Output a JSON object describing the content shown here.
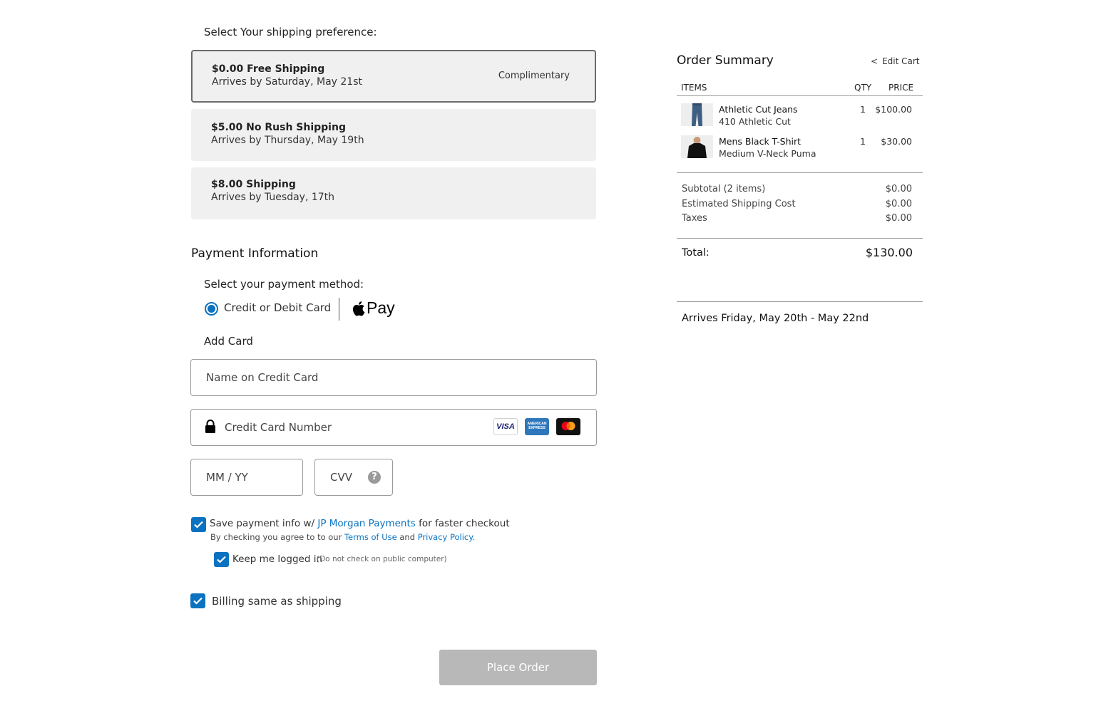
{
  "shipping": {
    "heading": "Select Your shipping preference:",
    "options": [
      {
        "title": "$0.00 Free Shipping",
        "subtitle": "Arrives by Saturday, May 21st",
        "tag": "Complimentary"
      },
      {
        "title": "$5.00 No Rush Shipping",
        "subtitle": "Arrives by Thursday, May 19th",
        "tag": ""
      },
      {
        "title": "$8.00 Shipping",
        "subtitle": "Arrives by Tuesday, 17th",
        "tag": ""
      }
    ]
  },
  "payment": {
    "heading": "Payment Information",
    "method_label": "Select your payment method:",
    "card_option": "Credit or Debit Card",
    "applepay_text": "Pay",
    "add_card": "Add Card",
    "name_placeholder": "Name on Credit Card",
    "number_placeholder": "Credit Card Number",
    "expiry_placeholder": "MM / YY",
    "cvv_placeholder": "CVV",
    "card_brands": {
      "visa": "VISA",
      "amex": "AMERICAN EXPRESS"
    }
  },
  "checkboxes": {
    "save_prefix": "Save payment info w/ ",
    "save_link": "JP Morgan Payments",
    "save_suffix": " for faster checkout",
    "agree_prefix": "By checking you agree to to our ",
    "terms_link": "Terms of Use",
    "agree_and": " and ",
    "privacy_link": "Privacy Policy.",
    "keep_logged": "Keep me logged in",
    "keep_note": "(Do not check on public computer)",
    "billing": "Billing same as shipping"
  },
  "place_order": "Place Order",
  "summary": {
    "title": "Order Summary",
    "edit_cart": "Edit Cart",
    "edit_cart_chevron": "<",
    "col_items": "ITEMS",
    "col_qty": "QTY",
    "col_price": "PRICE",
    "items": [
      {
        "name": "Athletic Cut Jeans",
        "variant": "410 Athletic Cut",
        "qty": "1",
        "price": "$100.00"
      },
      {
        "name": "Mens Black T-Shirt",
        "variant": "Medium V-Neck Puma",
        "qty": "1",
        "price": "$30.00"
      }
    ],
    "subtotal_label": "Subtotal (2 items)",
    "subtotal_value": "$0.00",
    "shipping_label": "Estimated Shipping Cost",
    "shipping_value": "$0.00",
    "taxes_label": "Taxes",
    "taxes_value": "$0.00",
    "total_label": "Total:",
    "total_value": "$130.00",
    "arrives": "Arrives Friday, May 20th - May 22nd"
  },
  "colors": {
    "accent": "#0a72c0",
    "option_bg": "#f0f0f0",
    "button_disabled": "#b8b8b8"
  }
}
